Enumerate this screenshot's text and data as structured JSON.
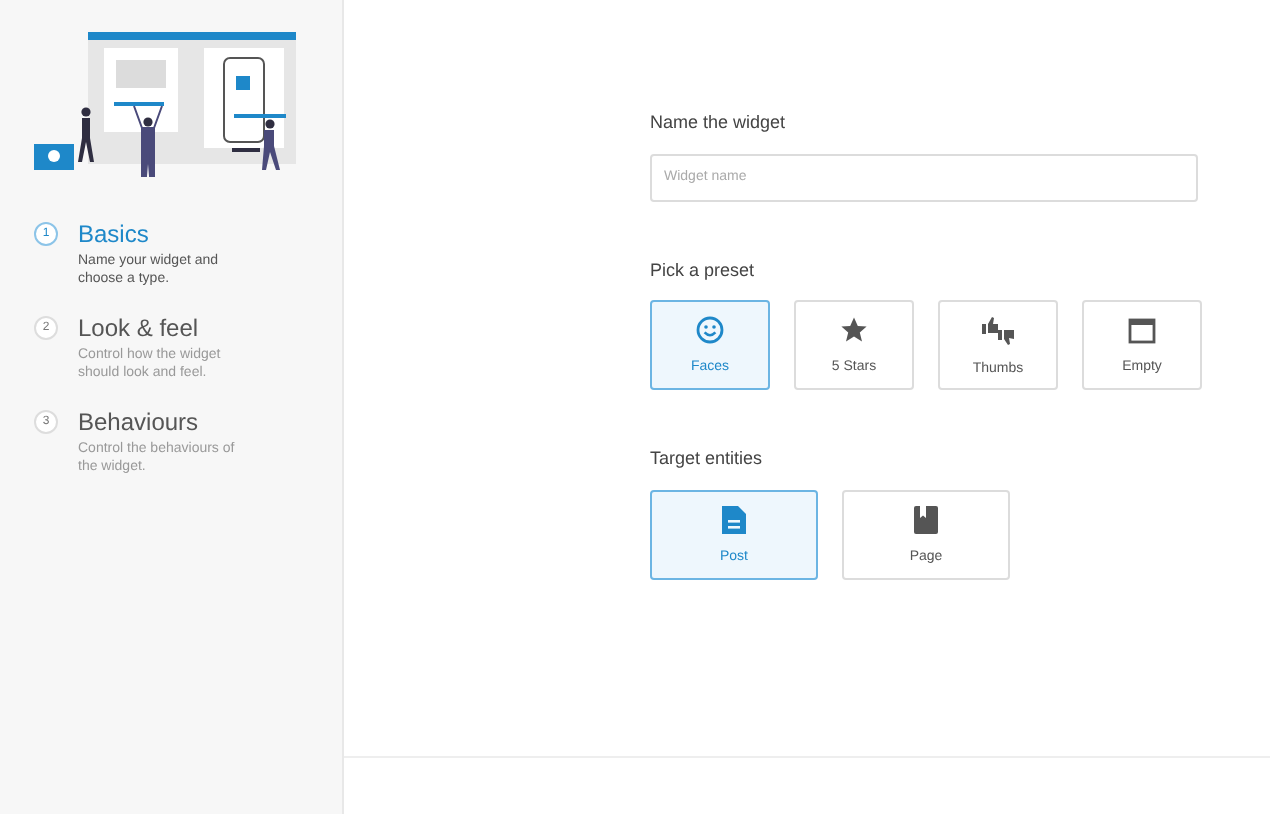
{
  "steps": [
    {
      "number": "1",
      "title": "Basics",
      "description": "Name your widget and choose a type.",
      "selected": true
    },
    {
      "number": "2",
      "title": "Look & feel",
      "description": "Control how the widget should look and feel.",
      "selected": false
    },
    {
      "number": "3",
      "title": "Behaviours",
      "description": "Control the behaviours of the widget.",
      "selected": false
    }
  ],
  "name_section": {
    "label": "Name the widget",
    "placeholder": "Widget name"
  },
  "preset_section": {
    "label": "Pick a preset",
    "options": [
      {
        "kind": "faces",
        "label": "Faces",
        "selected": true
      },
      {
        "kind": "stars",
        "label": "5 Stars",
        "selected": false
      },
      {
        "kind": "thumbs",
        "label": "Thumbs",
        "selected": false
      },
      {
        "kind": "empty",
        "label": "Empty",
        "selected": false
      }
    ]
  },
  "target_section": {
    "label": "Target entities",
    "options": [
      {
        "kind": "post",
        "label": "Post",
        "selected": true
      },
      {
        "kind": "page",
        "label": "Page",
        "selected": false
      }
    ]
  }
}
